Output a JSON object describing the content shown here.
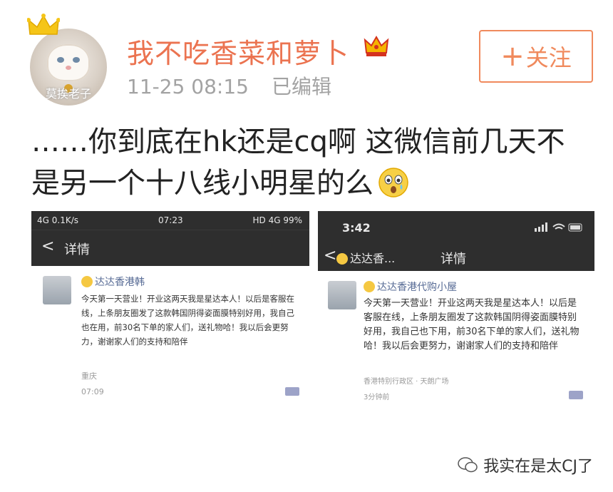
{
  "post": {
    "username": "我不吃香菜和萝卜",
    "avatar_caption": "莫挨老子",
    "time": "11-25 08:15",
    "edited": "已编辑",
    "follow_label": "关注",
    "text": "……你到底在hk还是cq啊 这微信前几天不是另一个十八线小明星的么"
  },
  "left_screenshot": {
    "status_left": "4G 0.1K/s",
    "status_time": "07:23",
    "status_right": "HD 4G 99%",
    "nav_back": "<",
    "nav_title": "详情",
    "account_name": "达达香港韩",
    "message": "今天第一天营业！开业这两天我是星达本人！以后是客服在线，上条朋友圈发了这款韩国阴得姿面膜特别好用，我自己也在用，前30名下单的家人们，送礼物哈！我以后会更努力，谢谢家人们的支持和陪伴",
    "location": "重庆",
    "timestamp": "07:09"
  },
  "right_screenshot": {
    "status_time": "3:42",
    "nav_back": "<",
    "nav_name": "达达香...",
    "nav_title": "详情",
    "account_name": "达达香港代购小屋",
    "message": "今天第一天营业！开业这两天我是星达本人！以后是客服在线，上条朋友圈发了这款韩国阴得姿面膜特别好用，我自己也下用，前30名下单的家人们，送礼物哈！我以后会更努力，谢谢家人们的支持和陪伴",
    "location": "香港特别行政区 · 天朗广场",
    "timestamp": "3分钟前"
  },
  "watermark": "我实在是太CJ了",
  "colors": {
    "username": "#eb7350",
    "follow": "#f08a5d",
    "meta": "#a3a3a3"
  }
}
